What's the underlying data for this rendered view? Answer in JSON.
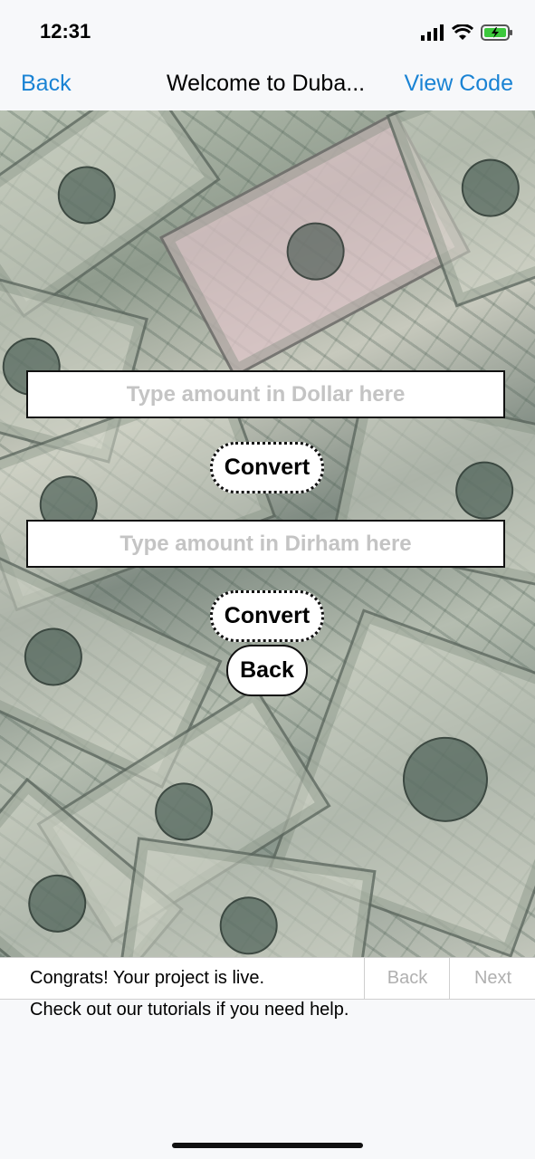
{
  "status_bar": {
    "time": "12:31",
    "battery_color": "#3cc83c"
  },
  "nav": {
    "back_label": "Back",
    "title": "Welcome to Duba...",
    "view_code_label": "View Code",
    "accent_color": "#1a83d4"
  },
  "background": {
    "icon": "money-bills-image"
  },
  "form": {
    "dollar_placeholder": "Type amount in Dollar here",
    "convert1_label": "Convert",
    "dirham_placeholder": "Type amount in Dirham here",
    "convert2_label": "Convert",
    "back_label": "Back"
  },
  "bottom_bar": {
    "message": "Congrats! Your project is live.",
    "back_label": "Back",
    "next_label": "Next"
  },
  "help_text": "Check out our tutorials if you need help."
}
